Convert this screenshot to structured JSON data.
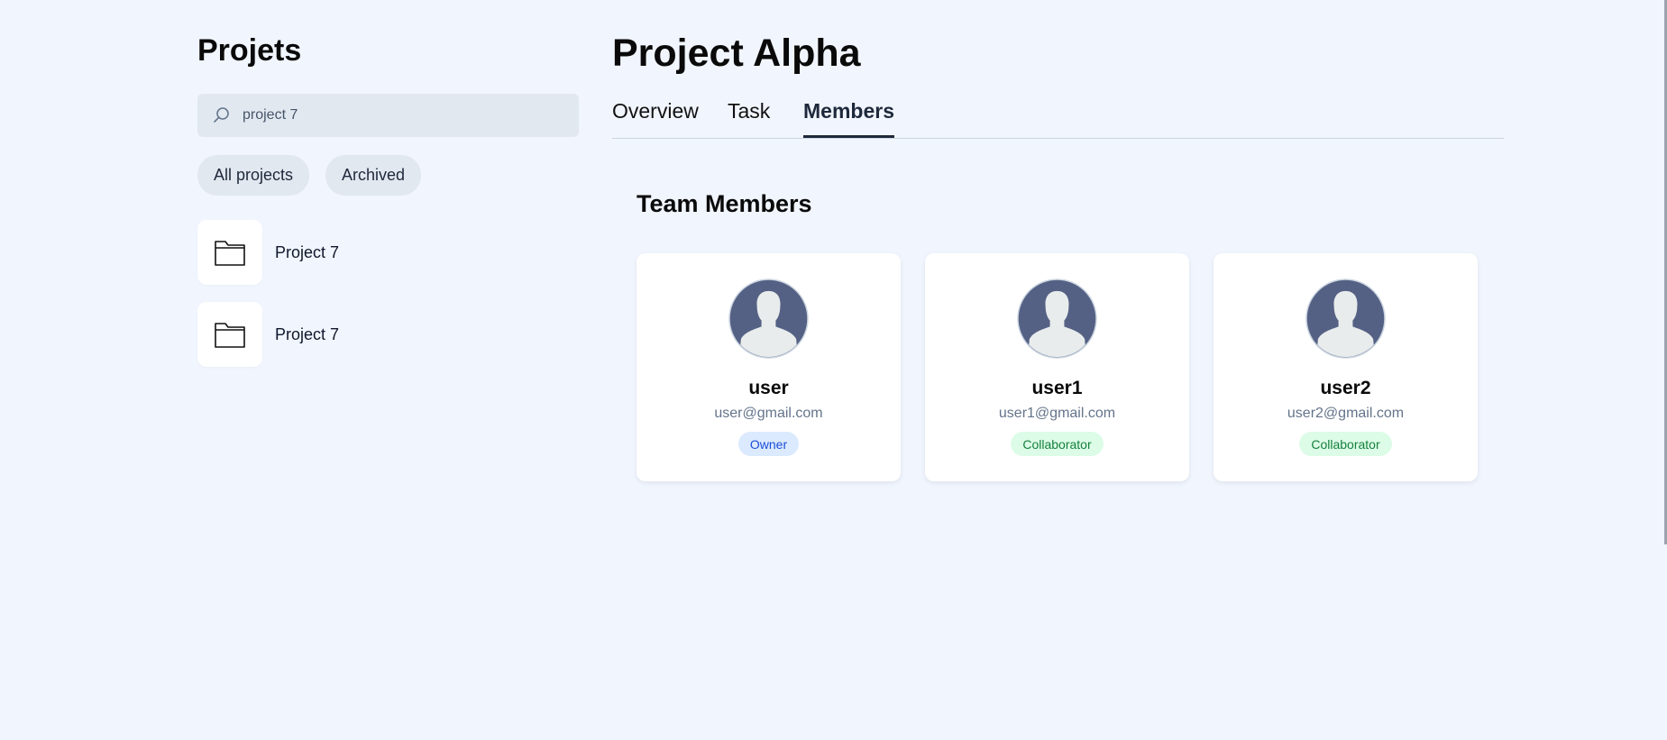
{
  "sidebar": {
    "title": "Projets",
    "search": {
      "value": "project 7",
      "placeholder": ""
    },
    "filters": [
      "All projects",
      "Archived"
    ],
    "projects": [
      {
        "name": "Project 7",
        "icon": "folder-icon"
      },
      {
        "name": "Project 7",
        "icon": "folder-icon"
      }
    ]
  },
  "main": {
    "title": "Project Alpha",
    "tabs": [
      {
        "label": "Overview",
        "active": false
      },
      {
        "label": "Task",
        "active": false
      },
      {
        "label": "Members",
        "active": true
      }
    ],
    "section_title": "Team Members",
    "members": [
      {
        "name": "user",
        "email": "user@gmail.com",
        "role": "Owner"
      },
      {
        "name": "user1",
        "email": "user1@gmail.com",
        "role": "Collaborator"
      },
      {
        "name": "user2",
        "email": "user2@gmail.com",
        "role": "Collaborator"
      }
    ]
  },
  "colors": {
    "background": "#f1f5fd",
    "owner_badge": "#dbeafe",
    "collaborator_badge": "#dcfce7",
    "avatar": "#556184"
  }
}
